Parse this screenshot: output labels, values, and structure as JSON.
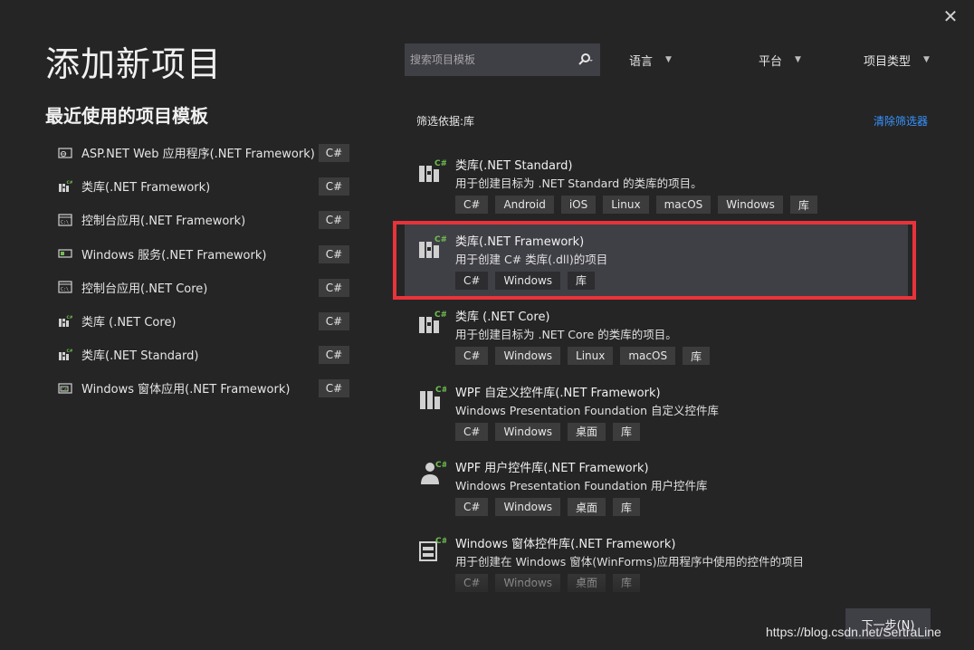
{
  "dialog": {
    "title": "添加新项目",
    "close_glyph": "✕"
  },
  "recent": {
    "header": "最近使用的项目模板",
    "items": [
      {
        "name": "ASP.NET Web 应用程序(.NET Framework)",
        "lang": "C#",
        "icon": "web-app-icon"
      },
      {
        "name": "类库(.NET Framework)",
        "lang": "C#",
        "icon": "class-library-icon"
      },
      {
        "name": "控制台应用(.NET Framework)",
        "lang": "C#",
        "icon": "console-app-icon"
      },
      {
        "name": "Windows 服务(.NET Framework)",
        "lang": "C#",
        "icon": "windows-service-icon"
      },
      {
        "name": "控制台应用(.NET Core)",
        "lang": "C#",
        "icon": "console-app-icon"
      },
      {
        "name": "类库 (.NET Core)",
        "lang": "C#",
        "icon": "class-library-icon"
      },
      {
        "name": "类库(.NET Standard)",
        "lang": "C#",
        "icon": "class-library-icon"
      },
      {
        "name": "Windows 窗体应用(.NET Framework)",
        "lang": "C#",
        "icon": "winforms-app-icon"
      }
    ]
  },
  "search": {
    "placeholder": "搜索项目模板"
  },
  "filters": {
    "language": "语言",
    "platform": "平台",
    "project_type": "项目类型"
  },
  "filter_status": {
    "label": "筛选依据:库",
    "clear": "清除筛选器"
  },
  "templates": [
    {
      "name": "类库(.NET Standard)",
      "desc": "用于创建目标为 .NET Standard 的类库的项目。",
      "tags": [
        "C#",
        "Android",
        "iOS",
        "Linux",
        "macOS",
        "Windows",
        "库"
      ],
      "icon": "class-library-icon",
      "selected": false
    },
    {
      "name": "类库(.NET Framework)",
      "desc": "用于创建 C# 类库(.dll)的项目",
      "tags": [
        "C#",
        "Windows",
        "库"
      ],
      "icon": "class-library-icon",
      "selected": true
    },
    {
      "name": "类库 (.NET Core)",
      "desc": "用于创建目标为 .NET Core 的类库的项目。",
      "tags": [
        "C#",
        "Windows",
        "Linux",
        "macOS",
        "库"
      ],
      "icon": "class-library-icon",
      "selected": false
    },
    {
      "name": "WPF 自定义控件库(.NET Framework)",
      "desc": "Windows Presentation Foundation 自定义控件库",
      "tags": [
        "C#",
        "Windows",
        "桌面",
        "库"
      ],
      "icon": "wpf-custom-control-icon",
      "selected": false
    },
    {
      "name": "WPF 用户控件库(.NET Framework)",
      "desc": "Windows Presentation Foundation 用户控件库",
      "tags": [
        "C#",
        "Windows",
        "桌面",
        "库"
      ],
      "icon": "wpf-user-control-icon",
      "selected": false
    },
    {
      "name": "Windows 窗体控件库(.NET Framework)",
      "desc": "用于创建在 Windows 窗体(WinForms)应用程序中使用的控件的项目",
      "tags": [
        "C#",
        "Windows",
        "桌面",
        "库"
      ],
      "icon": "winforms-control-icon",
      "selected": false
    }
  ],
  "footer": {
    "next_label": "下一步(N)"
  },
  "watermark": "https://blog.csdn.net/SertraLine",
  "colors": {
    "background": "#252526",
    "accent_link": "#3794ff",
    "highlight_border": "#e8333a",
    "csharp_green": "#6fbf4e"
  }
}
